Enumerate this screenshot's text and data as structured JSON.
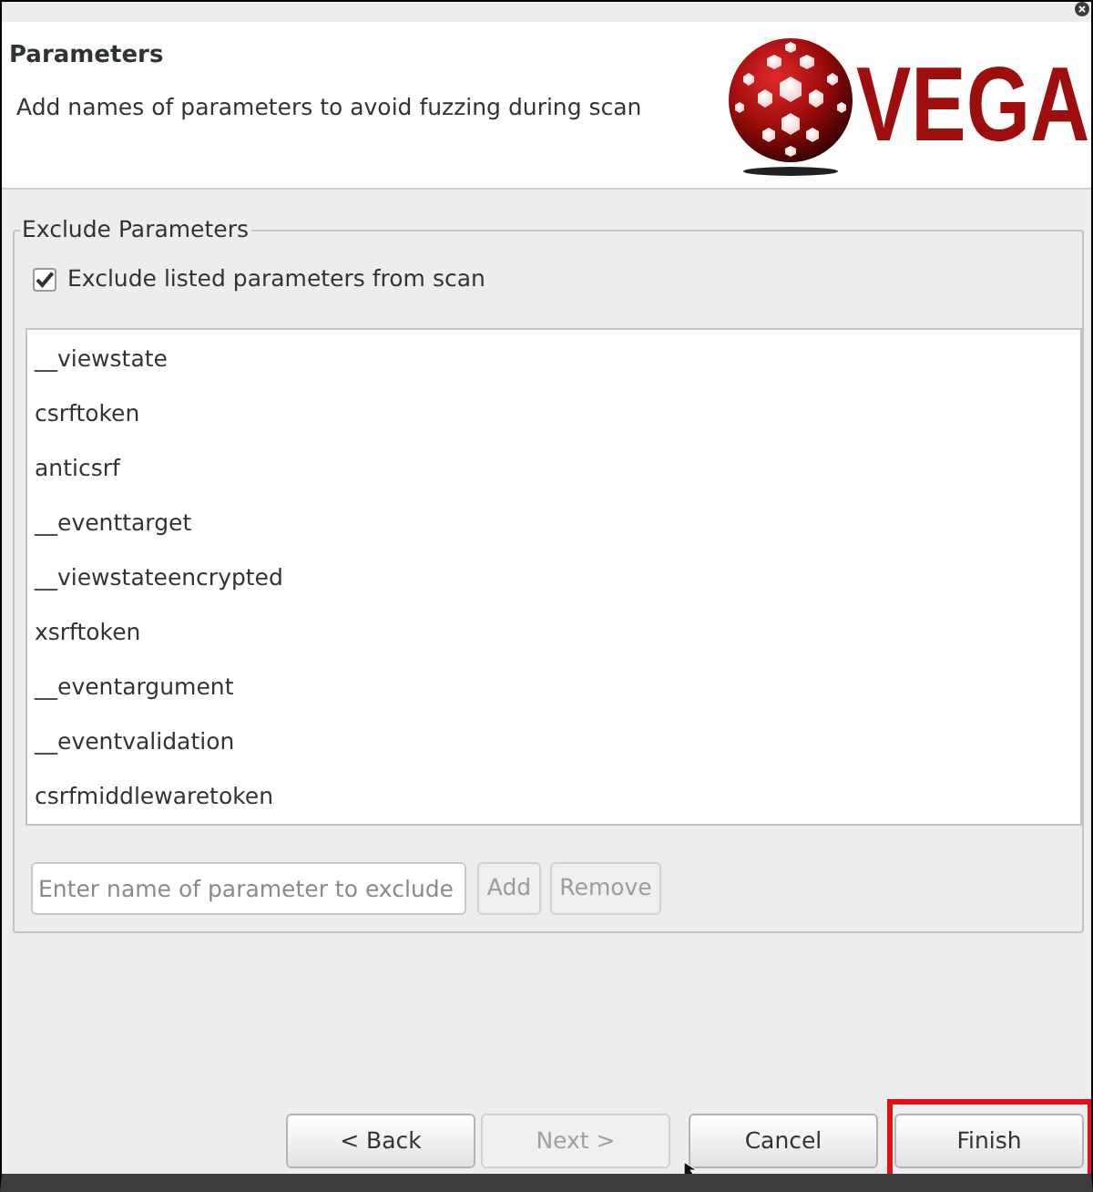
{
  "header": {
    "title": "Parameters",
    "description": "Add names of parameters to avoid fuzzing during scan",
    "logo_text": "VEGA"
  },
  "exclude_group": {
    "title": "Exclude Parameters",
    "checkbox": {
      "label": "Exclude listed parameters from scan",
      "checked": true
    },
    "parameters": [
      "__viewstate",
      "csrftoken",
      "anticsrf",
      "__eventtarget",
      "__viewstateencrypted",
      "xsrftoken",
      "__eventargument",
      "__eventvalidation",
      "csrfmiddlewaretoken"
    ],
    "input": {
      "placeholder": "Enter name of parameter to exclude"
    },
    "buttons": [
      {
        "label": "Add",
        "disabled": true
      },
      {
        "label": "Remove",
        "disabled": true
      }
    ]
  },
  "footer_buttons": [
    {
      "label": "< Back",
      "disabled": false,
      "highlighted": false
    },
    {
      "label": "Next >",
      "disabled": true,
      "highlighted": false
    },
    {
      "label": "Cancel",
      "disabled": false,
      "highlighted": false
    },
    {
      "label": "Finish",
      "disabled": false,
      "highlighted": true
    }
  ]
}
